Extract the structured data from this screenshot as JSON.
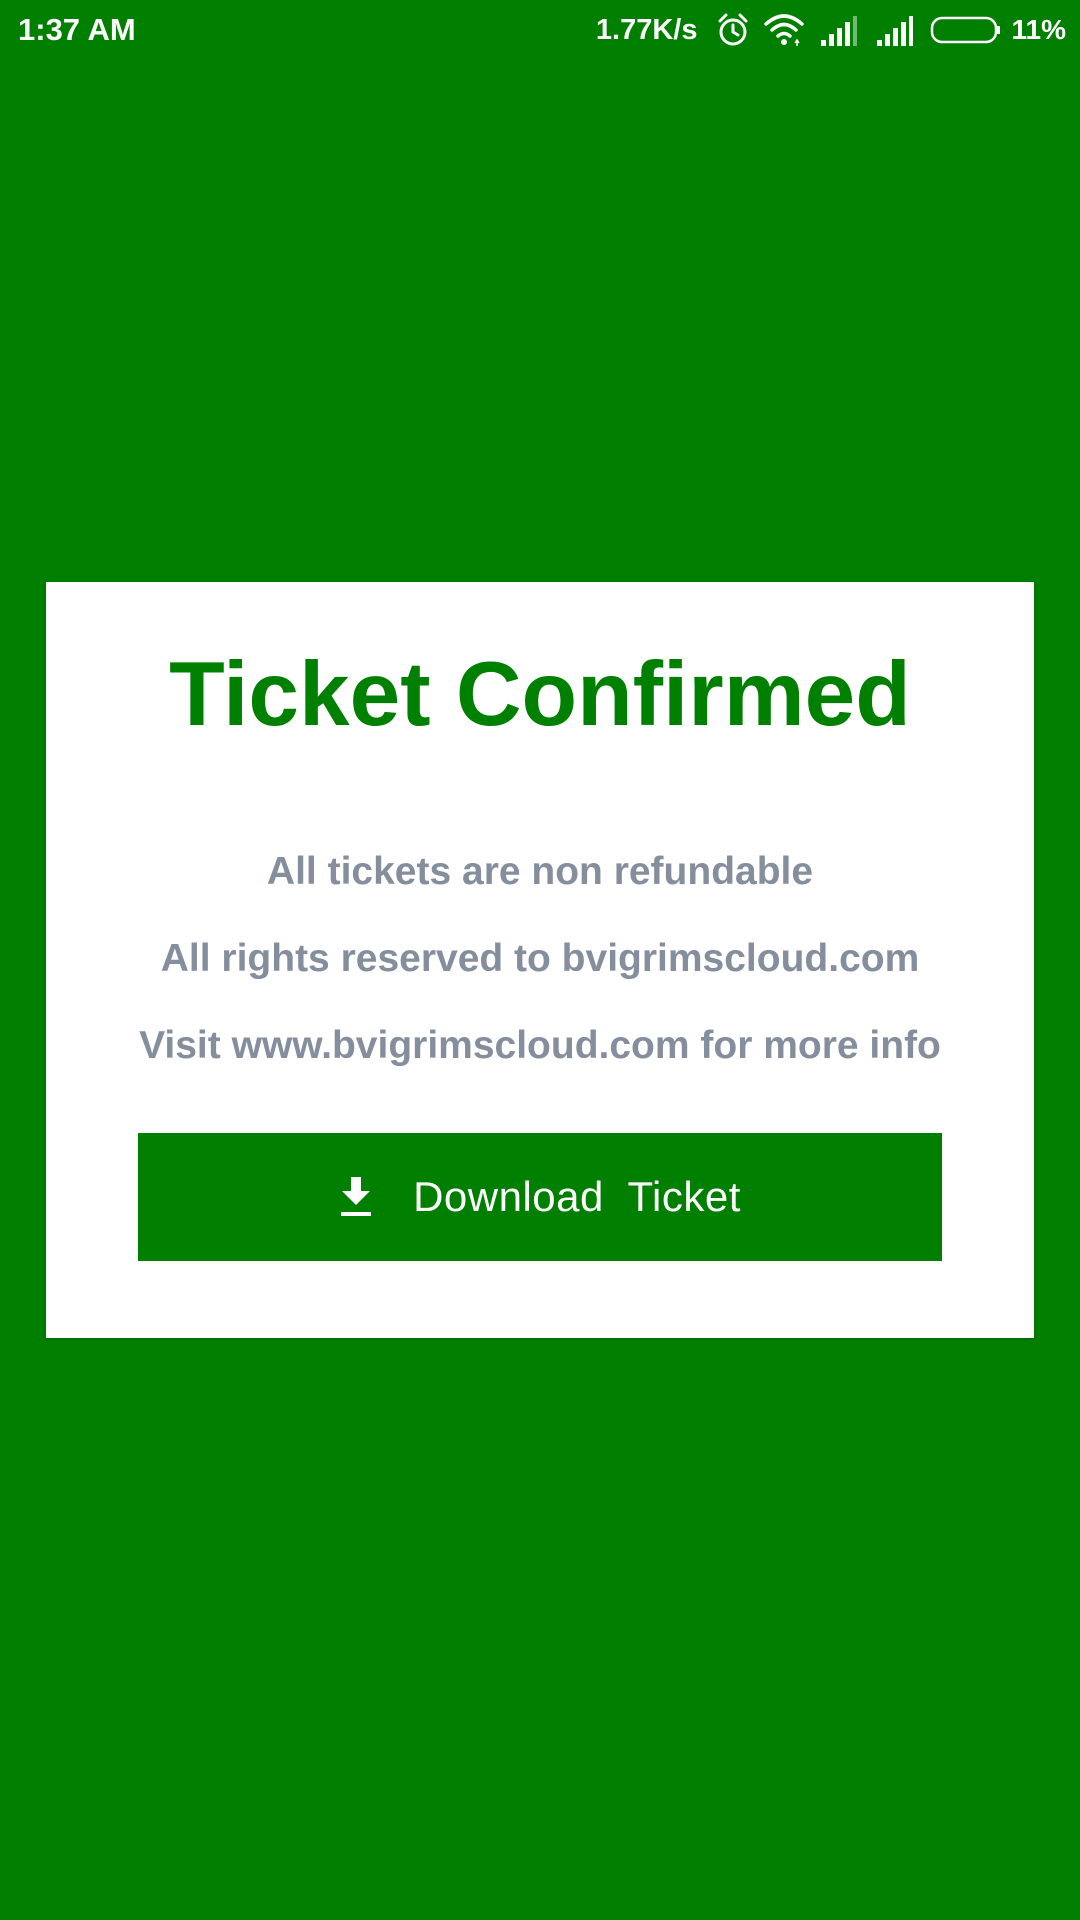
{
  "colors": {
    "background": "#007f00",
    "card": "#ffffff",
    "title": "#008000",
    "info_text": "#848e9c",
    "button": "#007f00",
    "button_text": "#ffffff",
    "status_text": "#ffffff"
  },
  "status_bar": {
    "time": "1:37 AM",
    "network_speed": "1.77K/s",
    "battery_percent": "11%",
    "battery_level": 0.11,
    "icons": [
      "alarm-icon",
      "wifi-icon",
      "signal-icon",
      "signal-icon",
      "battery-icon"
    ]
  },
  "card": {
    "title": "Ticket Confirmed",
    "info_lines": [
      "All tickets are non refundable",
      "All rights reserved to bvigrimscloud.com",
      "Visit www.bvigrimscloud.com for more info"
    ],
    "download_button": {
      "label": "Download  Ticket",
      "icon": "download-icon"
    }
  }
}
